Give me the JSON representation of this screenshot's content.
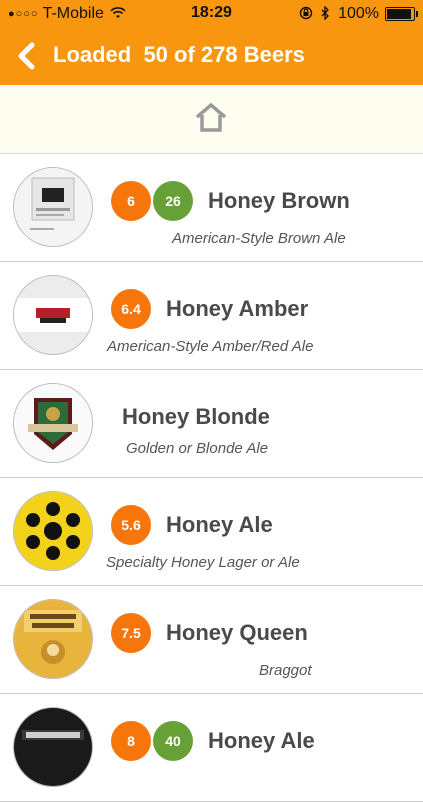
{
  "status_bar": {
    "carrier": "T-Mobile",
    "signal_dots": "●○○○",
    "time": "18:29",
    "battery": "100%",
    "battery_level": 1.0
  },
  "nav": {
    "back_icon": "chevron-left-icon",
    "title": "Loaded  50 of 278 Beers"
  },
  "home": {
    "icon": "home-icon"
  },
  "beers": [
    {
      "abv": "6",
      "ibu": "26",
      "name": "Honey Brown",
      "style": "American-Style Brown Ale"
    },
    {
      "abv": "6.4",
      "ibu": "",
      "name": "Honey Amber",
      "style": "American-Style Amber/Red Ale"
    },
    {
      "abv": "",
      "ibu": "",
      "name": "Honey Blonde",
      "style": "Golden or Blonde Ale"
    },
    {
      "abv": "5.6",
      "ibu": "",
      "name": "Honey Ale",
      "style": "Specialty Honey Lager or Ale"
    },
    {
      "abv": "7.5",
      "ibu": "",
      "name": "Honey Queen",
      "style": "Braggot"
    },
    {
      "abv": "8",
      "ibu": "40",
      "name": "Honey Ale",
      "style": ""
    }
  ],
  "colors": {
    "accent": "#f8960f",
    "abv_badge": "#f7760c",
    "ibu_badge": "#66a036"
  }
}
